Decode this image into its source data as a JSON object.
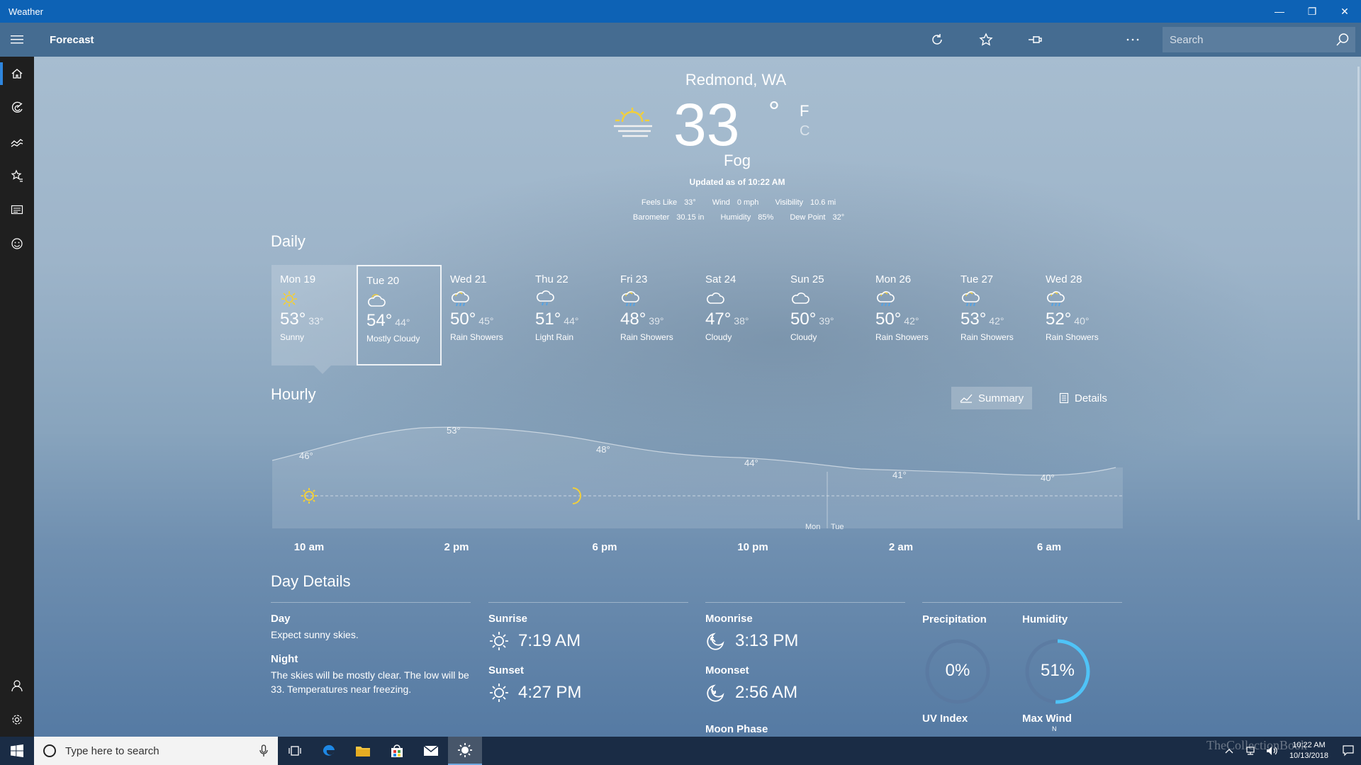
{
  "window": {
    "title": "Weather",
    "minimize": "—",
    "restore": "❐",
    "close": "✕"
  },
  "commandbar": {
    "page_title": "Forecast",
    "search_placeholder": "Search"
  },
  "current": {
    "location": "Redmond, WA",
    "temp": "33",
    "degree": "°",
    "unit_f": "F",
    "unit_c": "C",
    "condition": "Fog",
    "updated": "Updated as of 10:22 AM",
    "metrics": [
      {
        "label": "Feels Like",
        "value": "33°"
      },
      {
        "label": "Wind",
        "value": "0 mph"
      },
      {
        "label": "Visibility",
        "value": "10.6 mi"
      },
      {
        "label": "Barometer",
        "value": "30.15 in"
      },
      {
        "label": "Humidity",
        "value": "85%"
      },
      {
        "label": "Dew Point",
        "value": "32°"
      }
    ]
  },
  "daily": {
    "title": "Daily",
    "days": [
      {
        "name": "Mon 19",
        "hi": "53°",
        "lo": "33°",
        "cond": "Sunny",
        "icon": "sun-icon"
      },
      {
        "name": "Tue 20",
        "hi": "54°",
        "lo": "44°",
        "cond": "Mostly Cloudy",
        "icon": "mostly-cloudy-icon"
      },
      {
        "name": "Wed 21",
        "hi": "50°",
        "lo": "45°",
        "cond": "Rain Showers",
        "icon": "rain-showers-icon"
      },
      {
        "name": "Thu 22",
        "hi": "51°",
        "lo": "44°",
        "cond": "Light Rain",
        "icon": "light-rain-icon"
      },
      {
        "name": "Fri 23",
        "hi": "48°",
        "lo": "39°",
        "cond": "Rain Showers",
        "icon": "rain-showers-icon"
      },
      {
        "name": "Sat 24",
        "hi": "47°",
        "lo": "38°",
        "cond": "Cloudy",
        "icon": "cloudy-icon"
      },
      {
        "name": "Sun 25",
        "hi": "50°",
        "lo": "39°",
        "cond": "Cloudy",
        "icon": "cloudy-icon"
      },
      {
        "name": "Mon 26",
        "hi": "50°",
        "lo": "42°",
        "cond": "Rain Showers",
        "icon": "rain-showers-icon"
      },
      {
        "name": "Tue 27",
        "hi": "53°",
        "lo": "42°",
        "cond": "Rain Showers",
        "icon": "rain-showers-icon"
      },
      {
        "name": "Wed 28",
        "hi": "52°",
        "lo": "40°",
        "cond": "Rain Showers",
        "icon": "rain-showers-icon"
      }
    ]
  },
  "hourly": {
    "title": "Hourly",
    "summary_label": "Summary",
    "details_label": "Details",
    "temp_labels": [
      "46°",
      "53°",
      "48°",
      "44°",
      "41°",
      "40°"
    ],
    "times": [
      "10 am",
      "2 pm",
      "6 pm",
      "10 pm",
      "2 am",
      "6 am"
    ],
    "day_mon": "Mon",
    "day_tue": "Tue"
  },
  "day_details": {
    "title": "Day Details",
    "day_label": "Day",
    "day_text": "Expect sunny skies.",
    "night_label": "Night",
    "night_text": "The skies will be mostly clear. The low will be 33. Temperatures near freezing.",
    "sunrise_label": "Sunrise",
    "sunrise": "7:19 AM",
    "sunset_label": "Sunset",
    "sunset": "4:27 PM",
    "moonrise_label": "Moonrise",
    "moonrise": "3:13 PM",
    "moonset_label": "Moonset",
    "moonset": "2:56 AM",
    "moonphase_label": "Moon Phase",
    "precip_label": "Precipitation",
    "precip": "0%",
    "precip_fraction": 0,
    "humidity_label": "Humidity",
    "humidity": "51%",
    "humidity_fraction": 0.51,
    "uv_label": "UV Index",
    "maxwind_label": "Max Wind",
    "maxwind_dir": "N"
  },
  "taskbar": {
    "search_placeholder": "Type here to search",
    "time": "10:22 AM",
    "date": "10/13/2018"
  },
  "watermark": "TheCollectionBook",
  "colors": {
    "accent": "#0d62b5",
    "sun": "#f2cf3a",
    "ring": "#4fc3f7"
  }
}
